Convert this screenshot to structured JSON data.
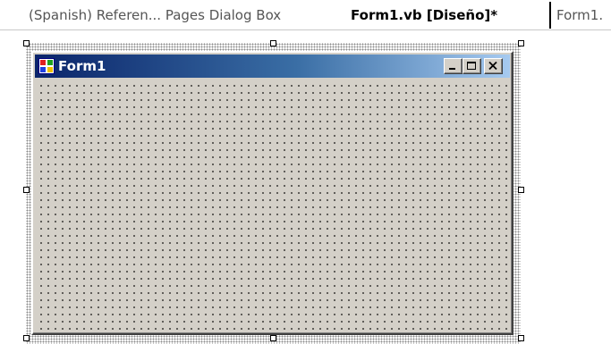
{
  "tabs": [
    {
      "label": "(Spanish) Referen... Pages Dialog Box",
      "active": false
    },
    {
      "label": "Form1.vb [Diseño]*",
      "active": true
    },
    {
      "label": "Form1.",
      "active": false
    }
  ],
  "form": {
    "title": "Form1",
    "icon": "form-window-icon",
    "caption_buttons": [
      "minimize-icon",
      "maximize-icon",
      "close-icon"
    ],
    "background_color": "#d4d0c8",
    "titlebar_color_start": "#0a246a",
    "titlebar_color_end": "#a6caf0"
  }
}
